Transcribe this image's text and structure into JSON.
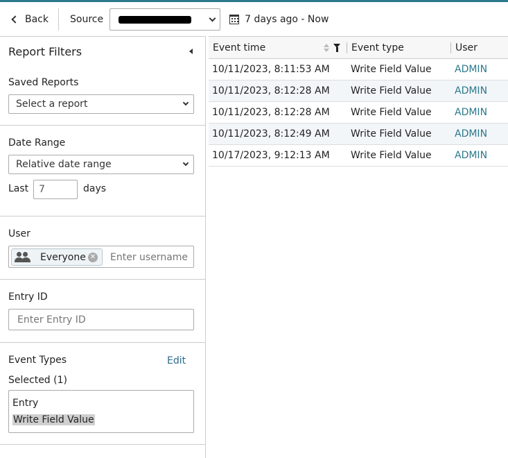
{
  "toolbar": {
    "back_label": "Back",
    "source_label": "Source",
    "source_value": "",
    "date_range_label": "7 days ago - Now"
  },
  "filters": {
    "title": "Report Filters",
    "saved_reports": {
      "label": "Saved Reports",
      "selected": "Select a report"
    },
    "date_range": {
      "label": "Date Range",
      "selected": "Relative date range",
      "last_label": "Last",
      "last_value": "7",
      "days_label": "days"
    },
    "user": {
      "label": "User",
      "chip_label": "Everyone",
      "placeholder": "Enter username"
    },
    "entry_id": {
      "label": "Entry ID",
      "placeholder": "Enter Entry ID"
    },
    "event_types": {
      "label": "Event Types",
      "edit_label": "Edit",
      "selected_label": "Selected (1)",
      "group": "Entry",
      "items": [
        "Write Field Value"
      ]
    }
  },
  "table": {
    "columns": [
      "Event time",
      "Event type",
      "User"
    ],
    "rows": [
      {
        "time": "10/11/2023, 8:11:53 AM",
        "type": "Write Field Value",
        "user": "ADMIN"
      },
      {
        "time": "10/11/2023, 8:12:28 AM",
        "type": "Write Field Value",
        "user": "ADMIN"
      },
      {
        "time": "10/11/2023, 8:12:28 AM",
        "type": "Write Field Value",
        "user": "ADMIN"
      },
      {
        "time": "10/11/2023, 8:12:49 AM",
        "type": "Write Field Value",
        "user": "ADMIN"
      },
      {
        "time": "10/17/2023, 9:12:13 AM",
        "type": "Write Field Value",
        "user": "ADMIN"
      }
    ]
  },
  "colors": {
    "accent": "#2b7a8c",
    "link": "#2b6a8c",
    "border": "#cccccc"
  }
}
